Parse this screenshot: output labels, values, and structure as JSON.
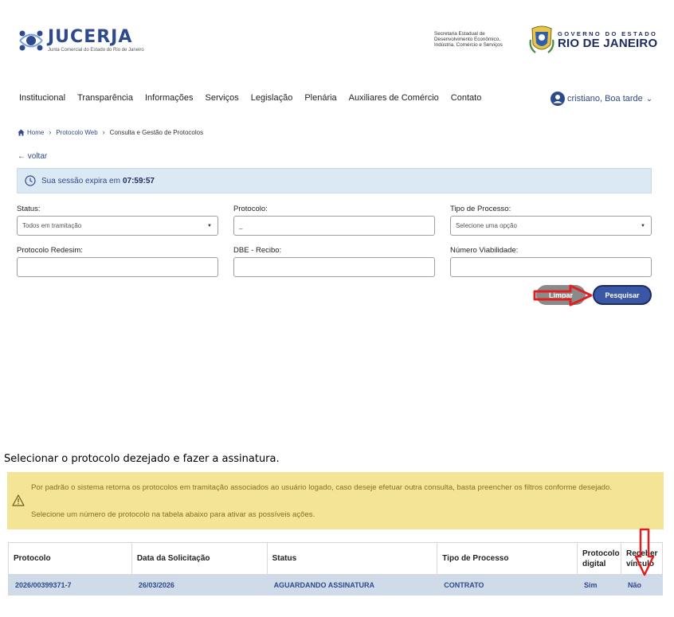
{
  "header": {
    "logo_name": "JUCERJA",
    "logo_subtitle": "Junta Comercial do Estado do Rio de Janeiro",
    "secretaria_lines": [
      "Secretaria Estadual de",
      "Desenvolvimento Econômico,",
      "Indústria, Comércio e Serviços"
    ],
    "gov_top": "GOVERNO DO ESTADO",
    "gov_big": "RIO DE JANEIRO"
  },
  "nav": {
    "items": [
      "Institucional",
      "Transparência",
      "Informações",
      "Serviços",
      "Legislação",
      "Plenária",
      "Auxiliares de Comércio",
      "Contato"
    ],
    "user_label": "cristiano, Boa tarde"
  },
  "breadcrumb": {
    "home": "Home",
    "level1": "Protocolo Web",
    "current": "Consulta e Gestão de Protocolos"
  },
  "back_label": "← voltar",
  "session": {
    "text": "Sua sessão expira em",
    "time": "07:59:57"
  },
  "form": {
    "status_label": "Status:",
    "status_value": "Todos em tramitação",
    "protocolo_label": "Protocolo:",
    "protocolo_value": "_",
    "tipo_label": "Tipo de Processo:",
    "tipo_value": "Selecione uma opção",
    "redesim_label": "Protocolo Redesim:",
    "dbe_label": "DBE - Recibo:",
    "viabilidade_label": "Número Viabilidade:",
    "clear_label": "Limpar",
    "search_label": "Pesquisar"
  },
  "instruction": "Selecionar o protocolo dezejado e fazer a assinatura.",
  "info": {
    "line1": "Por padrão o sistema retorna os protocolos em tramitação associados ao usuário logado, caso deseje efetuar outra consulta, basta preencher os filtros conforme desejado.",
    "line2": "Selecione um número de protocolo na tabela abaixo para ativar as possíveis ações."
  },
  "table": {
    "headers": [
      "Protocolo",
      "Data da Solicitação",
      "Status",
      "Tipo de Processo",
      "Protocolo digital",
      "Receber vínculo"
    ],
    "rows": [
      [
        "2026/00399371-7",
        "26/03/2026",
        "AGUARDANDO ASSINATURA",
        "CONTRATO",
        "Sim",
        "Não"
      ]
    ]
  },
  "colors": {
    "brand_blue": "#2f4a8c",
    "session_bg": "#dbe9f5",
    "info_bg": "#f3e496",
    "row_bg": "#cfdbe9",
    "annotation_red": "#e02020"
  }
}
